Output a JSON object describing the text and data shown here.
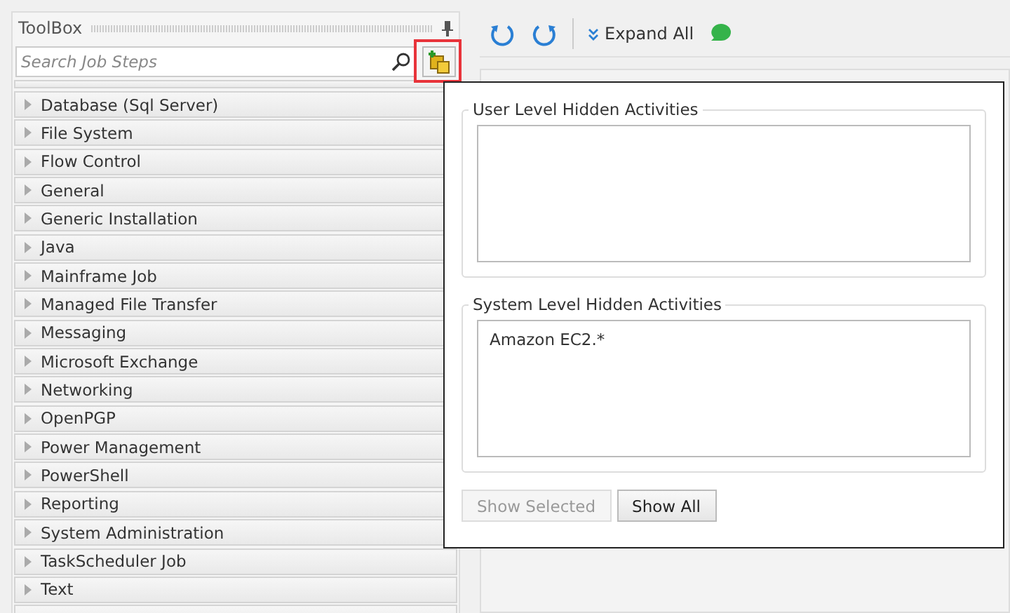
{
  "toolbox": {
    "title": "ToolBox",
    "search": {
      "placeholder": "Search Job Steps"
    },
    "categories": [
      {
        "label": "Database (Sql Server)",
        "expanded": false
      },
      {
        "label": "File System",
        "expanded": false
      },
      {
        "label": "Flow Control",
        "expanded": false
      },
      {
        "label": "General",
        "expanded": false
      },
      {
        "label": "Generic Installation",
        "expanded": false
      },
      {
        "label": "Java",
        "expanded": false
      },
      {
        "label": "Mainframe Job",
        "expanded": false
      },
      {
        "label": "Managed File Transfer",
        "expanded": false
      },
      {
        "label": "Messaging",
        "expanded": false
      },
      {
        "label": "Microsoft Exchange",
        "expanded": false
      },
      {
        "label": "Networking",
        "expanded": false
      },
      {
        "label": "OpenPGP",
        "expanded": false
      },
      {
        "label": "Power Management",
        "expanded": false
      },
      {
        "label": "PowerShell",
        "expanded": false
      },
      {
        "label": "Reporting",
        "expanded": false
      },
      {
        "label": "System Administration",
        "expanded": false
      },
      {
        "label": "TaskScheduler Job",
        "expanded": false
      },
      {
        "label": "Text",
        "expanded": false
      }
    ]
  },
  "toolbar": {
    "expand_all": "Expand All"
  },
  "popup": {
    "user_level": {
      "title": "User Level Hidden Activities"
    },
    "system_level": {
      "title": "System Level Hidden Activities",
      "items": [
        "Amazon EC2.*"
      ]
    },
    "buttons": [
      {
        "label": "Show Selected",
        "disabled": true
      },
      {
        "label": "Show All",
        "disabled": false
      }
    ]
  }
}
